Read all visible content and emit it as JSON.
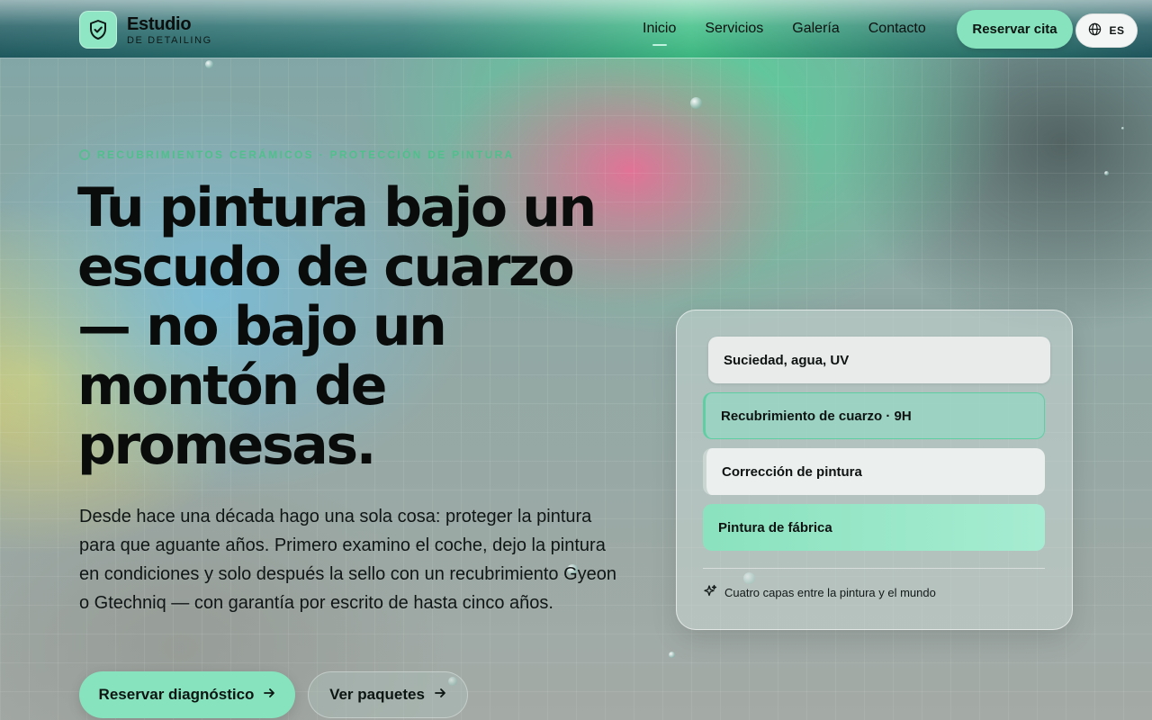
{
  "brand": {
    "name": "Estudio",
    "tagline": "DE DETAILING"
  },
  "nav": {
    "items": [
      {
        "label": "Inicio",
        "active": true
      },
      {
        "label": "Servicios",
        "active": false
      },
      {
        "label": "Galería",
        "active": false
      },
      {
        "label": "Contacto",
        "active": false
      }
    ],
    "cta_label": "Reservar cita",
    "language": "ES"
  },
  "hero": {
    "eyebrow": "RECUBRIMIENTOS CERÁMICOS · PROTECCIÓN DE PINTURA",
    "headline": "Tu pintura bajo un escudo de cuarzo — no bajo un montón de promesas.",
    "lead": "Desde hace una década hago una sola cosa: proteger la pintura para que aguante años. Primero examino el coche, dejo la pintura en condiciones y solo después la sello con un recubrimiento Gyeon o Gtechniq — con garantía por escrito de hasta cinco años.",
    "primary_cta": "Reservar diagnóstico",
    "secondary_cta": "Ver paquetes"
  },
  "layers_card": {
    "layers": [
      {
        "label": "Suciedad, agua, UV"
      },
      {
        "label": "Recubrimiento de cuarzo · 9H"
      },
      {
        "label": "Corrección de pintura"
      },
      {
        "label": "Pintura de fábrica"
      }
    ],
    "note": "Cuatro capas entre la pintura y el mundo"
  },
  "colors": {
    "accent": "#86e3bd",
    "accent_dark": "#4fc08c",
    "text": "#0d1110"
  },
  "icons": {
    "brand": "shield-check-icon",
    "language": "globe-icon",
    "cta_arrow": "arrow-right-icon",
    "note": "sparkle-icon"
  }
}
